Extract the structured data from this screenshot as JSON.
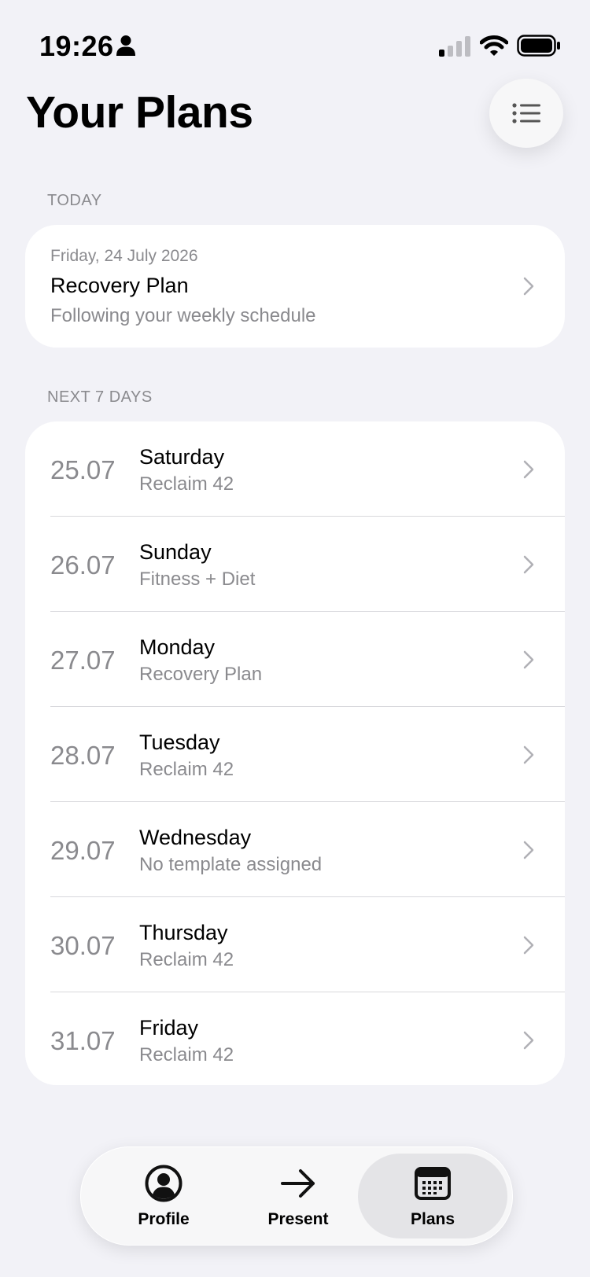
{
  "status_bar": {
    "time": "19:26"
  },
  "header": {
    "title": "Your Plans",
    "menu_icon": "list-icon"
  },
  "today": {
    "section_label": "TODAY",
    "date": "Friday, 24 July 2026",
    "title": "Recovery Plan",
    "subtitle": "Following your weekly schedule"
  },
  "next_days": {
    "section_label": "NEXT 7 DAYS",
    "items": [
      {
        "date": "25.07",
        "day": "Saturday",
        "plan": "Reclaim 42"
      },
      {
        "date": "26.07",
        "day": "Sunday",
        "plan": "Fitness + Diet"
      },
      {
        "date": "27.07",
        "day": "Monday",
        "plan": "Recovery Plan"
      },
      {
        "date": "28.07",
        "day": "Tuesday",
        "plan": "Reclaim 42"
      },
      {
        "date": "29.07",
        "day": "Wednesday",
        "plan": "No template assigned"
      },
      {
        "date": "30.07",
        "day": "Thursday",
        "plan": "Reclaim 42"
      },
      {
        "date": "31.07",
        "day": "Friday",
        "plan": "Reclaim 42"
      }
    ]
  },
  "tab_bar": {
    "tabs": [
      {
        "label": "Profile",
        "icon": "person-circle-icon"
      },
      {
        "label": "Present",
        "icon": "arrow-right-icon"
      },
      {
        "label": "Plans",
        "icon": "calendar-icon",
        "selected": true
      }
    ]
  },
  "colors": {
    "background": "#f2f2f7",
    "secondary_text": "#8a8a8e",
    "selected_tab": "#e4e4e7"
  }
}
